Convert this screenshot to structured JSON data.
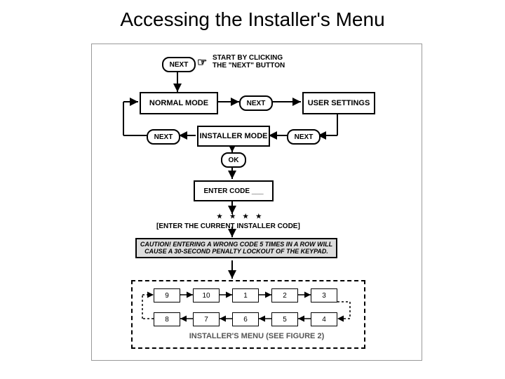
{
  "title": "Accessing the Installer's Menu",
  "start": {
    "next_label": "NEXT",
    "instruction_l1": "START BY CLICKING",
    "instruction_l2": "THE \"NEXT\" BUTTON"
  },
  "nodes": {
    "normal_mode": "NORMAL MODE",
    "user_settings": "USER SETTINGS",
    "installer_mode": "INSTALLER MODE",
    "enter_code": "ENTER CODE ___"
  },
  "connectors": {
    "next": "NEXT",
    "ok": "OK"
  },
  "code_hint": "★ ★ ★ ★",
  "enter_code_label": "[ENTER THE CURRENT INSTALLER CODE]",
  "caution": "CAUTION! ENTERING A WRONG CODE 5 TIMES IN A ROW WILL CAUSE A 30-SECOND PENALTY LOCKOUT OF THE KEYPAD.",
  "menu": {
    "cells": [
      "9",
      "10",
      "1",
      "2",
      "3",
      "8",
      "7",
      "6",
      "5",
      "4"
    ],
    "caption": "INSTALLER'S MENU (SEE FIGURE 2)"
  }
}
